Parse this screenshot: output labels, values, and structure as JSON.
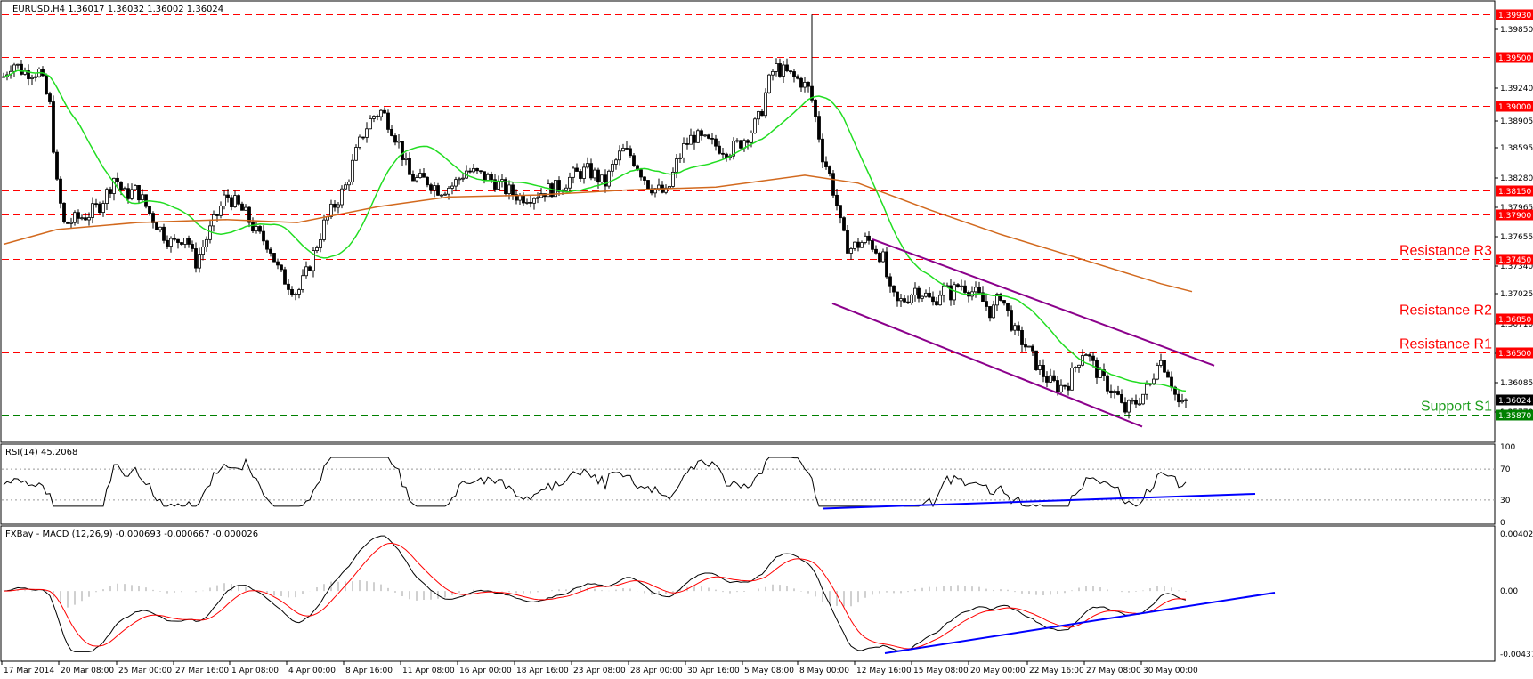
{
  "chart_data": {
    "type": "candlestick",
    "symbol_header": "EURUSD,H4  1.36017 1.36032 1.36002 1.36024",
    "price_axis": {
      "ylim": [
        1.3561,
        1.4005
      ],
      "ticks": [
        "1.39850",
        "1.39240",
        "1.38905",
        "1.38595",
        "1.38280",
        "1.37965",
        "1.37655",
        "1.37340",
        "1.37025",
        "1.36710",
        "1.36400",
        "1.36085",
        "1.35770"
      ]
    },
    "levels": [
      {
        "value": 1.3993,
        "label": "1.39930",
        "color": "#ff0000",
        "style": "dashed"
      },
      {
        "value": 1.395,
        "label": "1.39500",
        "color": "#ff0000",
        "style": "dashed"
      },
      {
        "value": 1.39,
        "label": "1.39000",
        "color": "#ff0000",
        "style": "dashed"
      },
      {
        "value": 1.3815,
        "label": "1.38150",
        "color": "#ff0000",
        "style": "dashed"
      },
      {
        "value": 1.379,
        "label": "1.37900",
        "color": "#ff0000",
        "style": "dashed"
      },
      {
        "value": 1.3745,
        "label": "1.37450",
        "color": "#ff0000",
        "style": "dashed",
        "name": "Resistance R3"
      },
      {
        "value": 1.3685,
        "label": "1.36850",
        "color": "#ff0000",
        "style": "dashed",
        "name": "Resistance R2"
      },
      {
        "value": 1.365,
        "label": "1.36500",
        "color": "#ff0000",
        "style": "dashed",
        "name": "Resistance R1"
      },
      {
        "value": 1.3587,
        "label": "1.35870",
        "color": "#008000",
        "style": "dashed",
        "name": "Support S1"
      }
    ],
    "current_price": {
      "value": 1.36024,
      "label": "1.36024"
    },
    "level_label_colors": {
      "resistance": "#ff0000",
      "support": "#1f9e1f"
    },
    "moving_average_colors": {
      "fast": "#22dd22",
      "slow": "#d2691e"
    },
    "channel_color": "#8b008b",
    "time_axis": [
      "17 Mar 2014",
      "20 Mar 08:00",
      "25 Mar 00:00",
      "27 Mar 16:00",
      "1 Apr 08:00",
      "4 Apr 00:00",
      "8 Apr 16:00",
      "11 Apr 08:00",
      "16 Apr 00:00",
      "18 Apr 16:00",
      "23 Apr 08:00",
      "28 Apr 00:00",
      "30 Apr 16:00",
      "5 May 08:00",
      "8 May 00:00",
      "12 May 16:00",
      "15 May 08:00",
      "20 May 00:00",
      "22 May 16:00",
      "27 May 08:00",
      "30 May 00:00"
    ],
    "rsi": {
      "title": "RSI(14) 45.2068",
      "ylim": [
        0,
        100
      ],
      "ticks": [
        "100",
        "70",
        "30",
        "0"
      ],
      "levels": [
        70,
        30
      ],
      "trendline_color": "#0000ff"
    },
    "macd": {
      "title": "FXBay - MACD (12,26,9) -0.000693 -0.000667 -0.000026",
      "ylim": [
        -0.004376,
        0.004025
      ],
      "ticks": [
        "0.004025",
        "0.00",
        "-0.004376"
      ],
      "macd_color": "#000000",
      "signal_color": "#ff0000",
      "histogram_color": "#a0a0a0",
      "trendline_color": "#0000ff"
    }
  }
}
